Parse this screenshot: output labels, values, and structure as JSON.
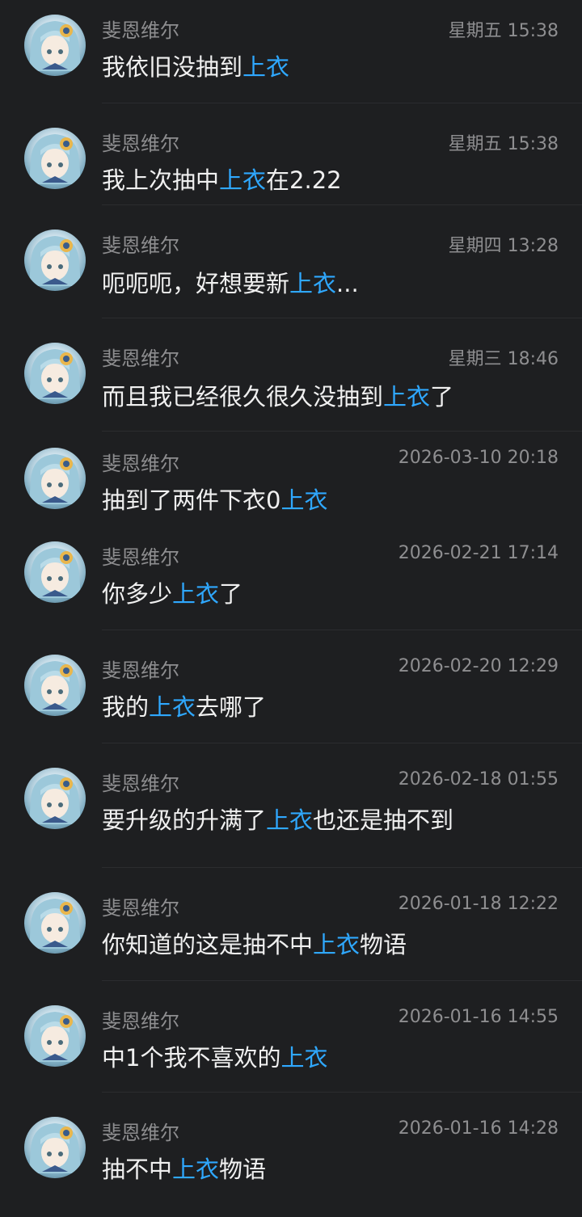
{
  "messages": [
    {
      "name": "斐恩维尔",
      "time": "星期五 15:38",
      "pre": "我依旧没抽到",
      "hl": "上衣",
      "post": ""
    },
    {
      "name": "斐恩维尔",
      "time": "星期五 15:38",
      "pre": "我上次抽中",
      "hl": "上衣",
      "post": "在2.22"
    },
    {
      "name": "斐恩维尔",
      "time": "星期四 13:28",
      "pre": "呃呃呃，好想要新",
      "hl": "上衣",
      "post": "..."
    },
    {
      "name": "斐恩维尔",
      "time": "星期三 18:46",
      "pre": "而且我已经很久很久没抽到",
      "hl": "上衣",
      "post": "了"
    },
    {
      "name": "斐恩维尔",
      "time": "2026-03-10 20:18",
      "pre": "抽到了两件下衣0",
      "hl": "上衣",
      "post": ""
    },
    {
      "name": "斐恩维尔",
      "time": "2026-02-21 17:14",
      "pre": "你多少",
      "hl": "上衣",
      "post": "了"
    },
    {
      "name": "斐恩维尔",
      "time": "2026-02-20 12:29",
      "pre": "我的",
      "hl": "上衣",
      "post": "去哪了"
    },
    {
      "name": "斐恩维尔",
      "time": "2026-02-18 01:55",
      "pre": "要升级的升满了",
      "hl": "上衣",
      "post": "也还是抽不到"
    },
    {
      "name": "斐恩维尔",
      "time": "2026-01-18 12:22",
      "pre": "你知道的这是抽不中",
      "hl": "上衣",
      "post": "物语"
    },
    {
      "name": "斐恩维尔",
      "time": "2026-01-16 14:55",
      "pre": "中1个我不喜欢的",
      "hl": "上衣",
      "post": ""
    },
    {
      "name": "斐恩维尔",
      "time": "2026-01-16 14:28",
      "pre": "抽不中",
      "hl": "上衣",
      "post": "物语"
    }
  ],
  "colors": {
    "background": "#1e1f21",
    "meta": "#8e8e90",
    "text": "#f0f0f0",
    "highlight": "#2fa8ff",
    "divider": "#2b2c2f"
  },
  "icons": {
    "avatar": "anime-character-avatar-icon"
  }
}
